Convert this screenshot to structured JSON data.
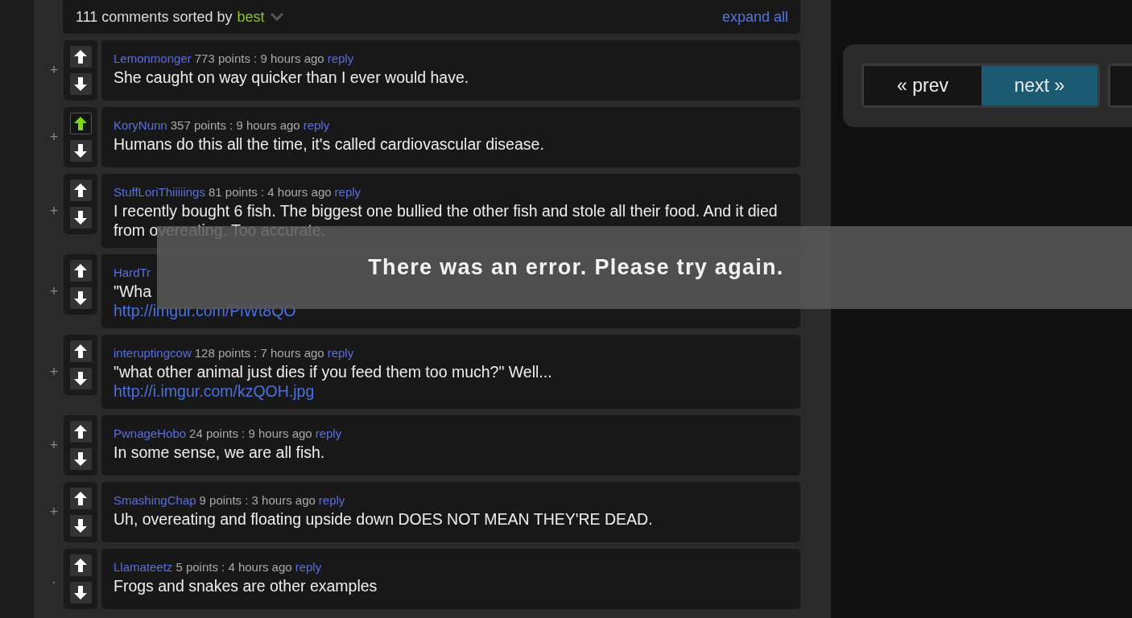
{
  "header": {
    "count_text": "111 comments sorted by",
    "sort": "best",
    "expand": "expand all"
  },
  "comments": [
    {
      "toggle": "+",
      "user": "Lemonmonger",
      "meta": "773 points : 9 hours ago",
      "reply": "reply",
      "upvoted": false,
      "body": "She caught on way quicker than I ever would have."
    },
    {
      "toggle": "+",
      "user": "KoryNunn",
      "meta": "357 points : 9 hours ago",
      "reply": "reply",
      "upvoted": true,
      "body": "Humans do this all the time, it's called cardiovascular disease."
    },
    {
      "toggle": "+",
      "user": "StuffLoriThiiiiings",
      "meta": "81 points : 4 hours ago",
      "reply": "reply",
      "upvoted": false,
      "body": "I recently bought 6 fish. The biggest one bullied the other fish and stole all their food. And it died from overeating. Too accurate."
    },
    {
      "toggle": "+",
      "user": "HardTr",
      "upvoted": false,
      "body": "\"Wha",
      "link": "http://imgur.com/PiWt8QO"
    },
    {
      "toggle": "+",
      "user": "interuptingcow",
      "meta": "128 points : 7 hours ago",
      "reply": "reply",
      "upvoted": false,
      "body": "\"what other animal just dies if you feed them too much?\" Well...",
      "link": "http://i.imgur.com/kzQOH.jpg"
    },
    {
      "toggle": "+",
      "user": "PwnageHobo",
      "meta": "24 points : 9 hours ago",
      "reply": "reply",
      "upvoted": false,
      "body": "In some sense, we are all fish."
    },
    {
      "toggle": "+",
      "user": "SmashingChap",
      "meta": "9 points : 3 hours ago",
      "reply": "reply",
      "upvoted": false,
      "body": "Uh, overeating and floating upside down DOES NOT MEAN THEY'RE DEAD."
    },
    {
      "toggle": ".",
      "user": "Llamateetz",
      "meta": "5 points : 4 hours ago",
      "reply": "reply",
      "upvoted": false,
      "body": "Frogs and snakes are other examples"
    }
  ],
  "pager": {
    "prev": "« prev",
    "next": "next »"
  },
  "error": "There was an error. Please try again."
}
